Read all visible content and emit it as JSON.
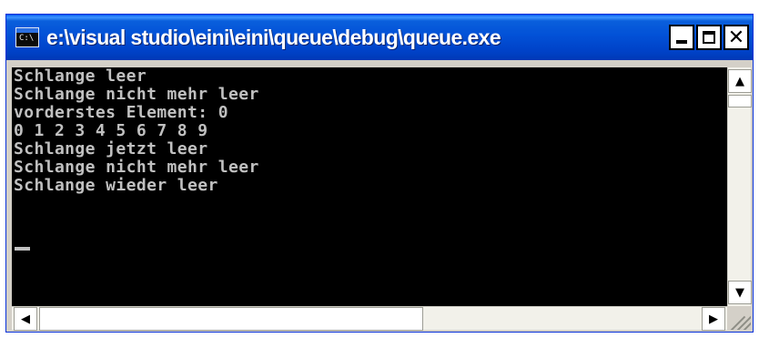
{
  "window": {
    "title": "e:\\visual studio\\eini\\eini\\queue\\debug\\queue.exe",
    "icon_text": "C:\\",
    "buttons": [
      "minimize",
      "maximize",
      "close"
    ]
  },
  "console": {
    "lines": [
      "Schlange leer",
      "Schlange nicht mehr leer",
      "vorderstes Element: 0",
      "0 1 2 3 4 5 6 7 8 9",
      "Schlange jetzt leer",
      "Schlange nicht mehr leer",
      "Schlange wieder leer"
    ],
    "text_color": "#c0c0c0",
    "background": "#000000"
  },
  "scroll_icons": {
    "up": "▲",
    "down": "▼",
    "left": "◀",
    "right": "▶"
  }
}
